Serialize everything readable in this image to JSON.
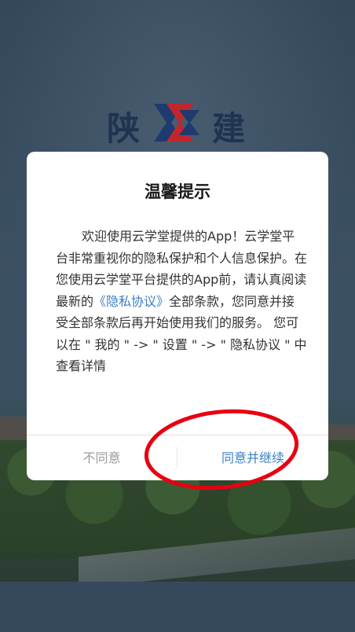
{
  "splash": {
    "logo": {
      "left_char": "陕",
      "right_char": "建",
      "mark_colors": [
        "#c0272d",
        "#1e3a6e"
      ]
    },
    "text_color": "#1e3450"
  },
  "dialog": {
    "title": "温馨提示",
    "body_before_link": "欢迎使用云学堂提供的App！云学堂平台非常重视你的隐私保护和个人信息保护。在您使用云学堂平台提供的App前，请认真阅读最新的",
    "link_text": "《隐私协议》",
    "body_after_link": "全部条款，您同意并接受全部条款后再开始使用我们的服务。 您可以在 \" 我的 \" -> \" 设置 \" -> \" 隐私协议 \" 中查看详情",
    "disagree_label": "不同意",
    "agree_label": "同意并继续"
  },
  "colors": {
    "link": "#3d7fc1",
    "disagree": "#9a9a9a",
    "annotation": "#e60012"
  }
}
